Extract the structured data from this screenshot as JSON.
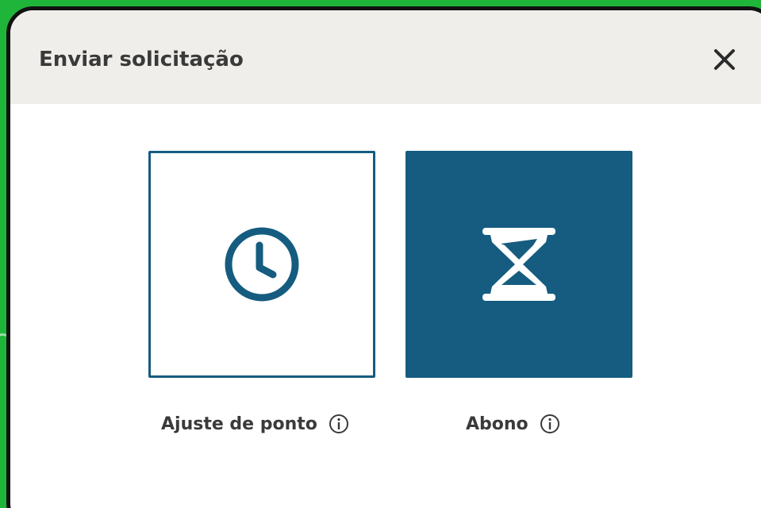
{
  "dialog": {
    "title": "Enviar solicitação",
    "close_icon": "close-icon"
  },
  "options": [
    {
      "label": "Ajuste de ponto",
      "icon": "clock-icon",
      "info_icon": "info-icon",
      "selected": false
    },
    {
      "label": "Abono",
      "icon": "hourglass-icon",
      "info_icon": "info-icon",
      "selected": true
    }
  ],
  "colors": {
    "accent": "#155c80",
    "header_bg": "#efeeea",
    "text": "#3a3a3a",
    "page_bg": "#1fb53a",
    "frame_border": "#111111"
  }
}
